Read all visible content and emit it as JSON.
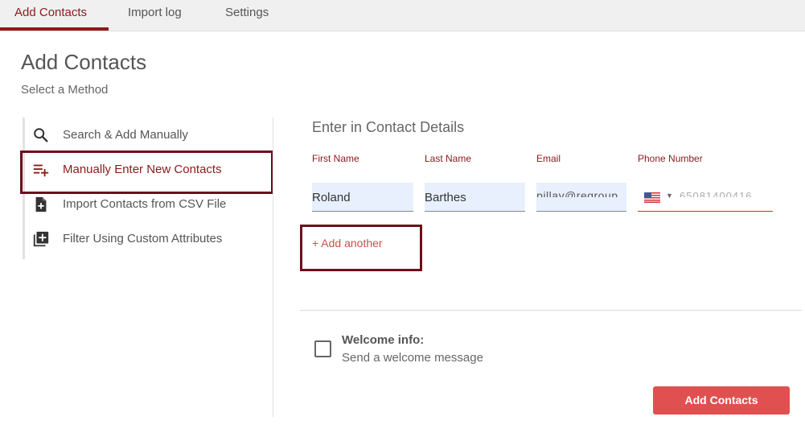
{
  "tabs": [
    {
      "label": "Add Contacts",
      "active": true
    },
    {
      "label": "Import log",
      "active": false
    },
    {
      "label": "Settings",
      "active": false
    }
  ],
  "page": {
    "title": "Add Contacts",
    "subtitle": "Select a Method"
  },
  "methods": [
    {
      "label": "Search & Add Manually",
      "icon": "search-icon",
      "selected": false
    },
    {
      "label": "Manually Enter New Contacts",
      "icon": "playlist-add-icon",
      "selected": true
    },
    {
      "label": "Import Contacts from CSV File",
      "icon": "file-add-icon",
      "selected": false
    },
    {
      "label": "Filter Using Custom Attributes",
      "icon": "library-add-icon",
      "selected": false
    }
  ],
  "form": {
    "section_title": "Enter in Contact Details",
    "labels": {
      "first_name": "First Name",
      "last_name": "Last Name",
      "email": "Email",
      "phone": "Phone Number"
    },
    "values": {
      "first_name": "Roland",
      "last_name": "Barthes",
      "email": "rpillay@regroup",
      "phone": "65081400416"
    },
    "phone_country_icon": "us-flag-icon",
    "add_another": "+ Add another"
  },
  "welcome": {
    "title": "Welcome info:",
    "subtitle": "Send a welcome message",
    "checked": false
  },
  "submit_label": "Add Contacts",
  "colors": {
    "brand": "#8b1a1a",
    "highlight_box": "#6e0d1d",
    "button": "#e05050",
    "field_bg": "#e8f0fe"
  }
}
